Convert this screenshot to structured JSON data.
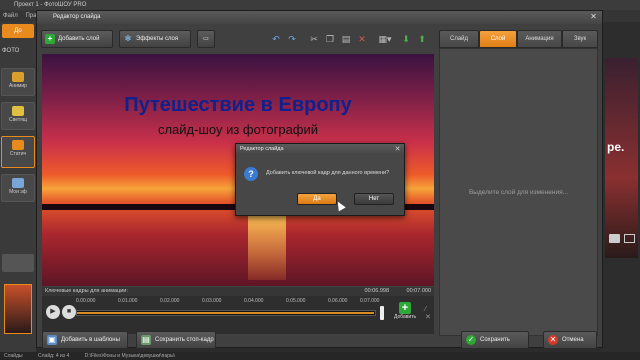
{
  "app": {
    "title": "Проект 1 - ФотоШОУ PRO",
    "menu": [
      "Файл",
      "Прав"
    ],
    "left_tabs": [
      "До",
      "ФОТО"
    ],
    "left_buttons": [
      "Анимир",
      "Светящ",
      "Статич",
      "Мои эф"
    ],
    "right_side_text": "pe.",
    "status": {
      "slides_label": "Слайды",
      "slide_info": "Слайд: 4 из 4",
      "path": "D:\\Files\\Фоны и Музыка\\девушки\\пары\\"
    }
  },
  "editor": {
    "title": "Редактор слайда",
    "toolbar": {
      "add_layer": "Добавить слой",
      "layer_effects": "Эффекты слоя"
    },
    "tabs": [
      {
        "label": "Слайд",
        "active": false
      },
      {
        "label": "Слой",
        "active": true
      },
      {
        "label": "Анимация",
        "active": false
      },
      {
        "label": "Звук",
        "active": false
      }
    ],
    "right_panel_hint": "Выделите слой для изменения...",
    "preview": {
      "title": "Путешествие в Европу",
      "subtitle": "слайд-шоу из фотографий"
    },
    "timeline": {
      "header_label": "Ключевые кадры для анимации:",
      "time_current": "00:06.998",
      "time_total": "00:07.000",
      "ticks": [
        "0.00.000",
        "0.01.000",
        "0.02.000",
        "0.03.000",
        "0.04.000",
        "0.05.000",
        "0.06.000",
        "0.07.000"
      ],
      "progress": 0.997,
      "add_label": "Добавить"
    },
    "bottom": {
      "add_to_templates": "Добавить в шаблоны",
      "save_still": "Сохранить стоп-кадр",
      "save": "Сохранить",
      "cancel": "Отмена"
    }
  },
  "confirm": {
    "title": "Редактор слайда",
    "message": "Добавить ключевой кадр для данного времени?",
    "yes": "Да",
    "no": "Нет"
  },
  "colors": {
    "accent_orange": "#e88a1e",
    "save_green": "#2ea836",
    "cancel_red": "#d43a2a",
    "title_blue": "#10208c"
  }
}
